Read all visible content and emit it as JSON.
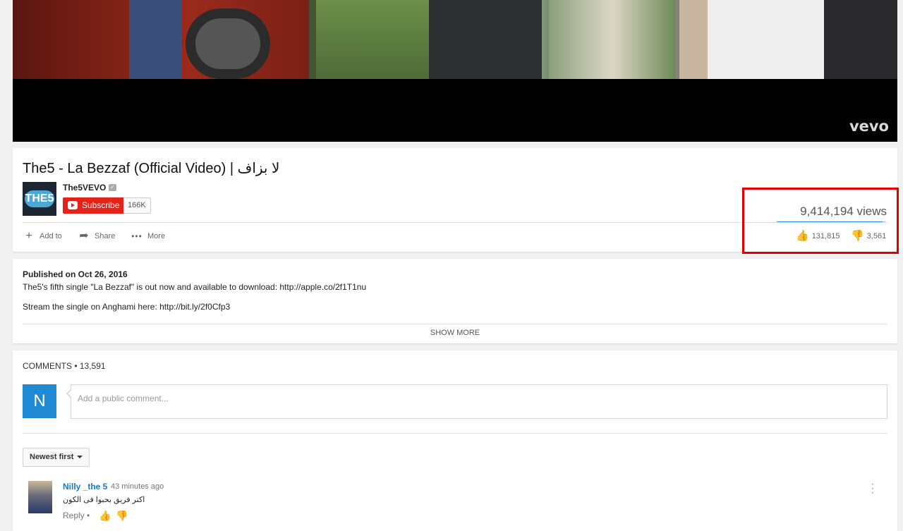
{
  "video": {
    "watermark": "vevo"
  },
  "info": {
    "title": "The5 - La Bezzaf (Official Video) | لا بزاف",
    "channel": "The5VEVO",
    "channel_avatar_text": "THE5",
    "subscribe_label": "Subscribe",
    "subscriber_count": "166K",
    "actions": [
      {
        "label": "Add to",
        "icon": "plus-icon"
      },
      {
        "label": "Share",
        "icon": "share-icon"
      },
      {
        "label": "More",
        "icon": "more-dots-icon"
      }
    ],
    "views": "9,414,194 views",
    "likes": "131,815",
    "dislikes": "3,561",
    "like_ratio": 0.974
  },
  "description": {
    "published": "Published on Oct 26, 2016",
    "lines": [
      "The5's fifth single \"La Bezzaf\" is out now and available to download: http://apple.co/2f1T1nu",
      "Stream the single on Anghami here: http://bit.ly/2f0Cfp3"
    ],
    "show_more": "SHOW MORE"
  },
  "comments": {
    "header": "COMMENTS • 13,591",
    "user_initial": "N",
    "input_placeholder": "Add a public comment...",
    "sort_label": "Newest first",
    "items": [
      {
        "author": "Nilly _the 5",
        "time": "43 minutes ago",
        "text": "اكتر فريق بحبوا فى الكون",
        "reply_label": "Reply •"
      }
    ]
  },
  "colors": {
    "accent_red": "#e62117",
    "link_blue": "#167ac6",
    "highlight": "#e00000"
  }
}
